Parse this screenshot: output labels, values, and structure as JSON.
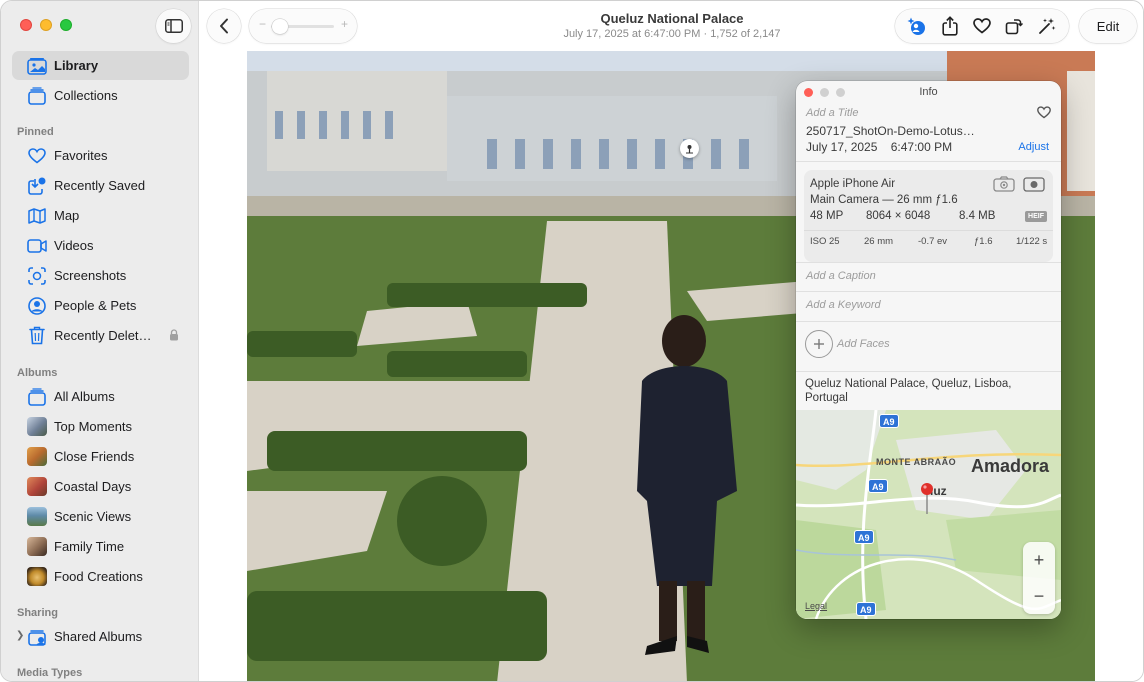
{
  "sidebar": {
    "top_items": [
      {
        "label": "Library",
        "icon": "library-icon",
        "selected": true
      },
      {
        "label": "Collections",
        "icon": "collections-icon",
        "selected": false
      }
    ],
    "sections": {
      "pinned": "Pinned",
      "albums": "Albums",
      "sharing": "Sharing",
      "media_types": "Media Types"
    },
    "pinned_items": [
      {
        "label": "Favorites",
        "icon": "heart-icon"
      },
      {
        "label": "Recently Saved",
        "icon": "recently-saved-icon"
      },
      {
        "label": "Map",
        "icon": "map-icon"
      },
      {
        "label": "Videos",
        "icon": "video-icon"
      },
      {
        "label": "Screenshots",
        "icon": "screenshot-icon"
      },
      {
        "label": "People & Pets",
        "icon": "person-icon"
      },
      {
        "label": "Recently Delet…",
        "icon": "trash-icon",
        "locked": true
      }
    ],
    "album_items": [
      {
        "label": "All Albums",
        "icon": "albums-icon"
      },
      {
        "label": "Top Moments",
        "icon": "album-thumbnail",
        "thumb_color": "#7a8aa0"
      },
      {
        "label": "Close Friends",
        "icon": "album-thumbnail",
        "thumb_color": "#b86a2e"
      },
      {
        "label": "Coastal Days",
        "icon": "album-thumbnail",
        "thumb_color": "#b0443a"
      },
      {
        "label": "Scenic Views",
        "icon": "album-thumbnail",
        "thumb_color": "#5e8aa8"
      },
      {
        "label": "Family Time",
        "icon": "album-thumbnail",
        "thumb_color": "#8a6a52"
      },
      {
        "label": "Food Creations",
        "icon": "album-thumbnail",
        "thumb_color": "#c08a2a"
      }
    ],
    "sharing_items": [
      {
        "label": "Shared Albums",
        "icon": "shared-albums-icon"
      }
    ]
  },
  "toolbar": {
    "zoom_minus": "−",
    "zoom_plus": "+",
    "zoom_level": 0.05,
    "title": "Queluz National Palace",
    "subtitle": "July 17, 2025 at 6:47:00 PM  ·  1,752 of 2,147",
    "edit_label": "Edit",
    "action_icons": [
      "visual-lookup-icon",
      "share-icon",
      "heart-icon",
      "rotate-icon",
      "enhance-icon"
    ]
  },
  "info_panel": {
    "title": "Info",
    "title_placeholder": "Add a Title",
    "filename": "250717_ShotOn-Demo-Lotus…",
    "date": "July 17, 2025",
    "time": "6:47:00 PM",
    "adjust_label": "Adjust",
    "camera": {
      "model": "Apple iPhone Air",
      "lens": "Main Camera — 26 mm ƒ1.6",
      "megapixels": "48 MP",
      "resolution": "8064 × 6048",
      "file_size": "8.4 MB",
      "format": "HEIF",
      "exif": [
        "ISO 25",
        "26 mm",
        "-0.7 ev",
        "ƒ1.6",
        "1/122 s"
      ]
    },
    "caption_placeholder": "Add a Caption",
    "keyword_placeholder": "Add a Keyword",
    "faces_placeholder": "Add Faces",
    "location": "Queluz National Palace, Queluz, Lisboa, Portugal",
    "map": {
      "labels": [
        "MONTE ABRAÃO",
        "Amadora",
        "luz"
      ],
      "road_signs": [
        "A9",
        "A9",
        "A9",
        "A9"
      ],
      "zoom_in": "+",
      "zoom_out": "−",
      "legal": "Legal"
    }
  }
}
